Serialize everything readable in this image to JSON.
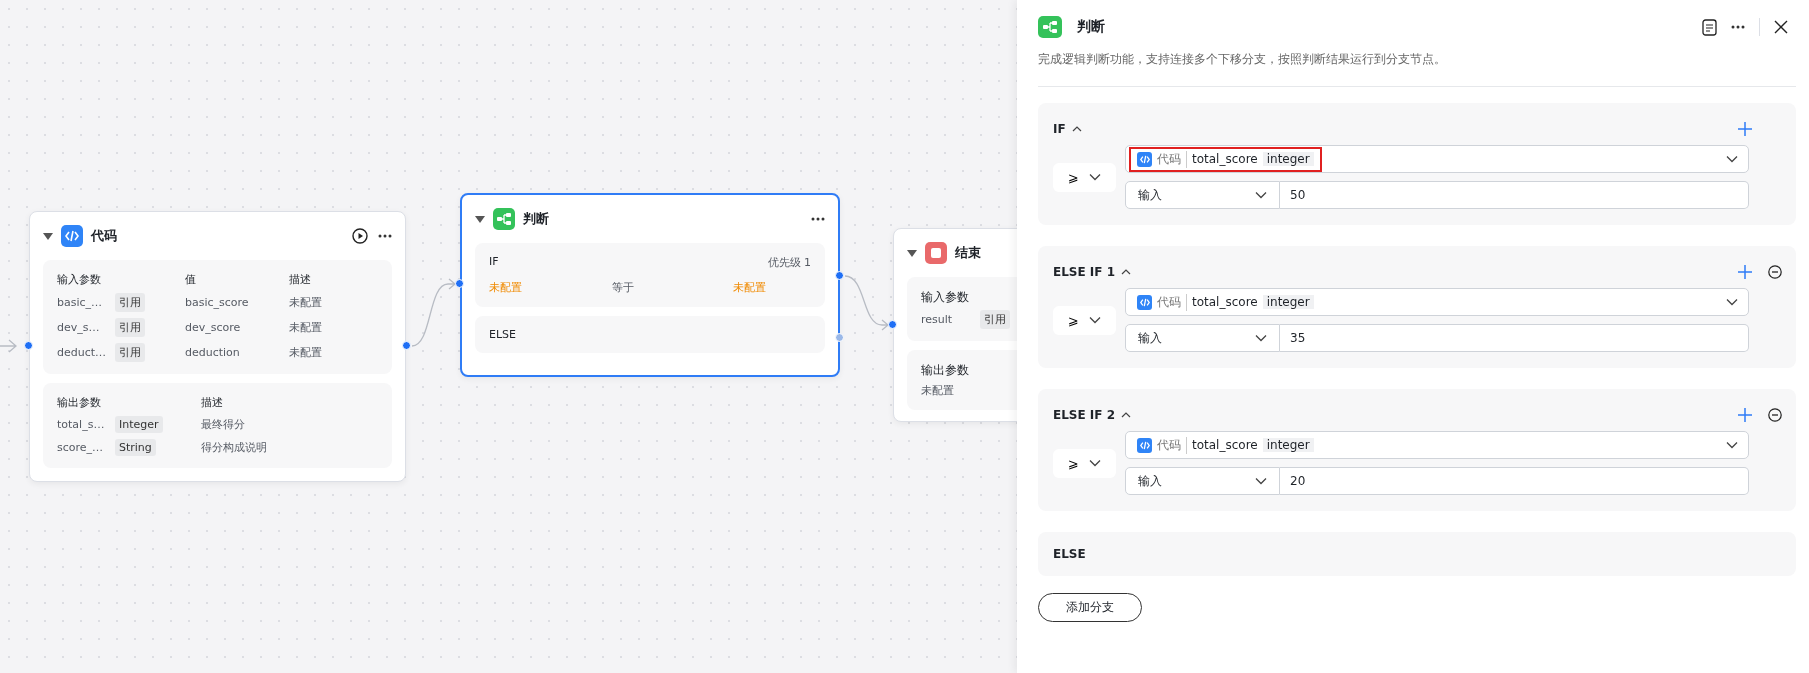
{
  "canvas": {
    "nodes": [
      {
        "kind": "code",
        "title": "代码",
        "selected": false,
        "inputs": {
          "header": [
            "输入参数",
            "值",
            "描述"
          ],
          "rows": [
            {
              "name": "basic_…",
              "tag": "引用",
              "value": "basic_score",
              "desc": "未配置"
            },
            {
              "name": "dev_s…",
              "tag": "引用",
              "value": "dev_score",
              "desc": "未配置"
            },
            {
              "name": "deduct…",
              "tag": "引用",
              "value": "deduction",
              "desc": "未配置"
            }
          ]
        },
        "outputs": {
          "header": [
            "输出参数",
            "描述"
          ],
          "rows": [
            {
              "name": "total_s…",
              "tag": "Integer",
              "desc": "最终得分"
            },
            {
              "name": "score_…",
              "tag": "String",
              "desc": "得分构成说明"
            }
          ]
        }
      },
      {
        "kind": "condition",
        "title": "判断",
        "selected": true,
        "branches": [
          {
            "kind": "if",
            "label": "IF",
            "priority": "优先级 1",
            "left": "未配置",
            "operator": "等于",
            "right": "未配置"
          },
          {
            "kind": "else",
            "label": "ELSE"
          }
        ]
      },
      {
        "kind": "end",
        "title": "结束",
        "selected": false,
        "input_label": "输入参数",
        "input_row": {
          "name": "result",
          "tag": "引用"
        },
        "output_label": "输出参数",
        "output_value": "未配置"
      }
    ]
  },
  "panel": {
    "title": "判断",
    "description": "完成逻辑判断功能，支持连接多个下移分支，按照判断结果运行到分支节点。",
    "branches": [
      {
        "kind": "condition",
        "label": "IF",
        "expanded": true,
        "removable": false,
        "operator": "⩾",
        "source": {
          "node": "代码",
          "variable": "total_score",
          "type": "integer",
          "highlighted": true
        },
        "value_mode": "输入",
        "value": "50"
      },
      {
        "kind": "condition",
        "label": "ELSE IF 1",
        "expanded": true,
        "removable": true,
        "operator": "⩾",
        "source": {
          "node": "代码",
          "variable": "total_score",
          "type": "integer",
          "highlighted": false
        },
        "value_mode": "输入",
        "value": "35"
      },
      {
        "kind": "condition",
        "label": "ELSE IF 2",
        "expanded": true,
        "removable": true,
        "operator": "⩾",
        "source": {
          "node": "代码",
          "variable": "total_score",
          "type": "integer",
          "highlighted": false
        },
        "value_mode": "输入",
        "value": "20"
      },
      {
        "kind": "else",
        "label": "ELSE"
      }
    ],
    "add_button": "添加分支"
  }
}
